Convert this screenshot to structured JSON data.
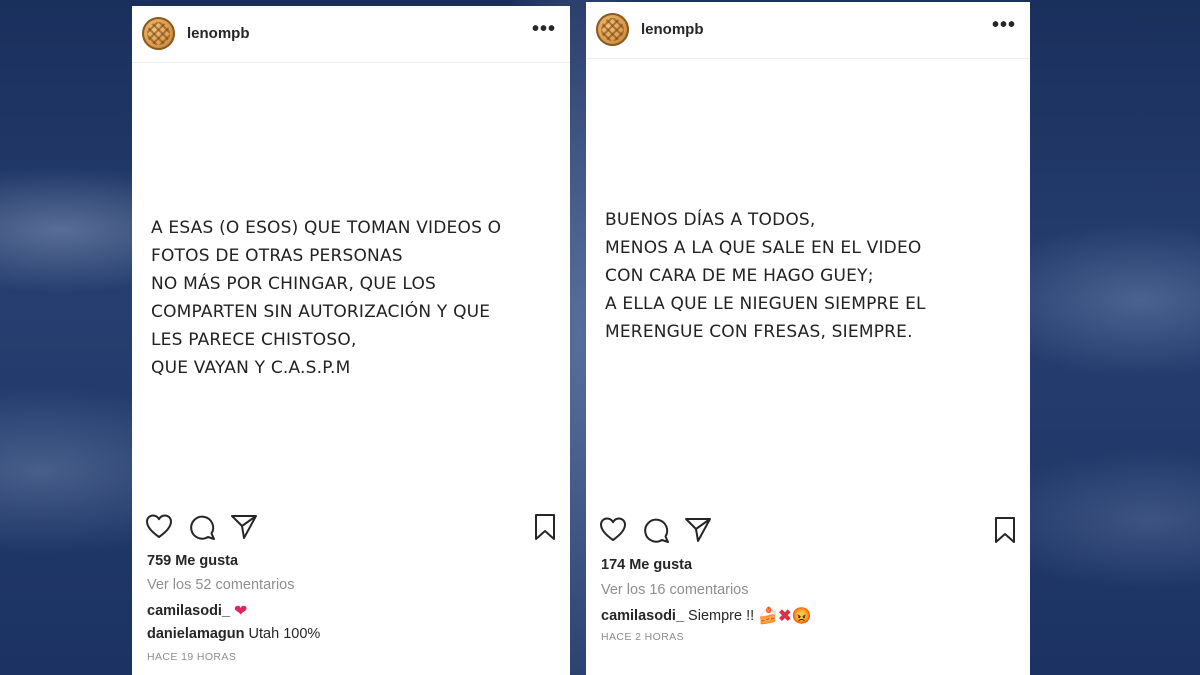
{
  "colors": {
    "background": "#1d3563",
    "card": "#ffffff",
    "text": "#262626",
    "muted": "#8e8e8e",
    "heart_emoji": "#e0245e"
  },
  "posts": [
    {
      "username": "lenompb",
      "more_icon": "more-horizontal-icon",
      "avatar": "cookie-avatar",
      "text_lines": [
        "A ESAS (O ESOS) QUE TOMAN VIDEOS O",
        "FOTOS DE OTRAS PERSONAS",
        "NO MÁS POR CHINGAR, QUE LOS",
        "COMPARTEN SIN AUTORIZACIÓN Y QUE",
        "LES PARECE CHISTOSO,",
        "QUE VAYAN Y C.A.S.P.M"
      ],
      "actions": [
        "heart-icon",
        "comment-icon",
        "share-icon",
        "bookmark-icon"
      ],
      "likes": "759 Me gusta",
      "view_comments": "Ver los 52 comentarios",
      "comments": [
        {
          "user": "camilasodi_",
          "text": "",
          "emoji": [
            "❤"
          ]
        },
        {
          "user": "danielamagun",
          "text": "Utah 100%",
          "emoji": []
        }
      ],
      "timestamp": "HACE 19 HORAS"
    },
    {
      "username": "lenompb",
      "more_icon": "more-horizontal-icon",
      "avatar": "cookie-avatar",
      "text_lines": [
        "BUENOS DÍAS A TODOS,",
        "MENOS A LA QUE SALE EN EL VIDEO",
        "CON CARA DE ME HAGO GUEY;",
        "A ELLA QUE LE NIEGUEN SIEMPRE EL",
        "MERENGUE CON FRESAS, SIEMPRE."
      ],
      "actions": [
        "heart-icon",
        "comment-icon",
        "share-icon",
        "bookmark-icon"
      ],
      "likes": "174 Me gusta",
      "view_comments": "Ver los 16 comentarios",
      "comments": [
        {
          "user": "camilasodi_",
          "text": "Siempre !!",
          "emoji": [
            "🍰",
            "✖",
            "😡"
          ]
        }
      ],
      "timestamp": "HACE 2 HORAS"
    }
  ]
}
